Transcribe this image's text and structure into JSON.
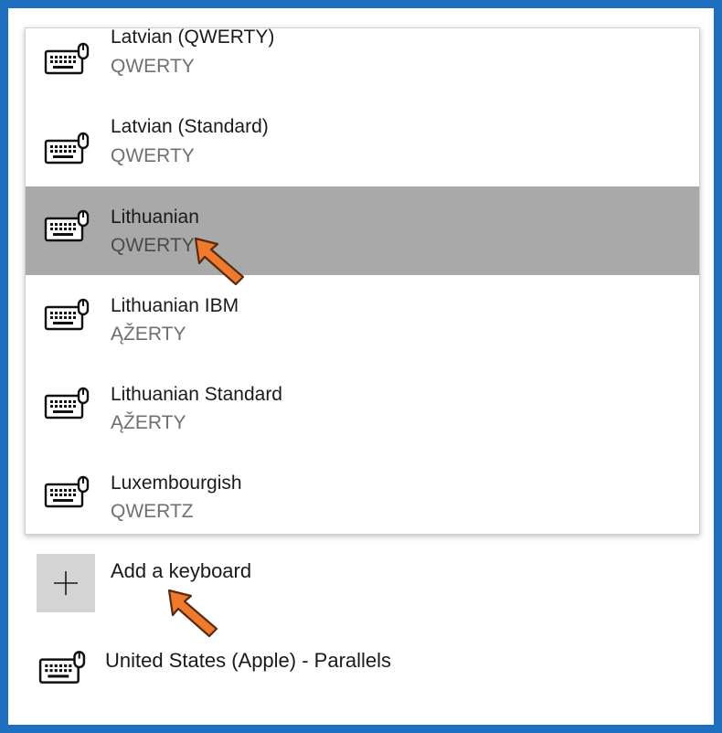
{
  "keyboard_list": {
    "items": [
      {
        "name": "Latvian (QWERTY)",
        "layout": "QWERTY"
      },
      {
        "name": "Latvian (Standard)",
        "layout": "QWERTY"
      },
      {
        "name": "Lithuanian",
        "layout": "QWERTY"
      },
      {
        "name": "Lithuanian IBM",
        "layout": "ĄŽERTY"
      },
      {
        "name": "Lithuanian Standard",
        "layout": "ĄŽERTY"
      },
      {
        "name": "Luxembourgish",
        "layout": "QWERTZ"
      }
    ],
    "selected_index": 2
  },
  "add_keyboard": {
    "icon": "plus-icon",
    "label": "Add a keyboard"
  },
  "installed_keyboard": {
    "icon": "keyboard-icon",
    "label": "United States (Apple) - Parallels"
  },
  "colors": {
    "frame": "#1f6fc0",
    "selected_row": "#a9a9a9",
    "add_button": "#d4d4d4",
    "arrow": "#f07a2c"
  }
}
